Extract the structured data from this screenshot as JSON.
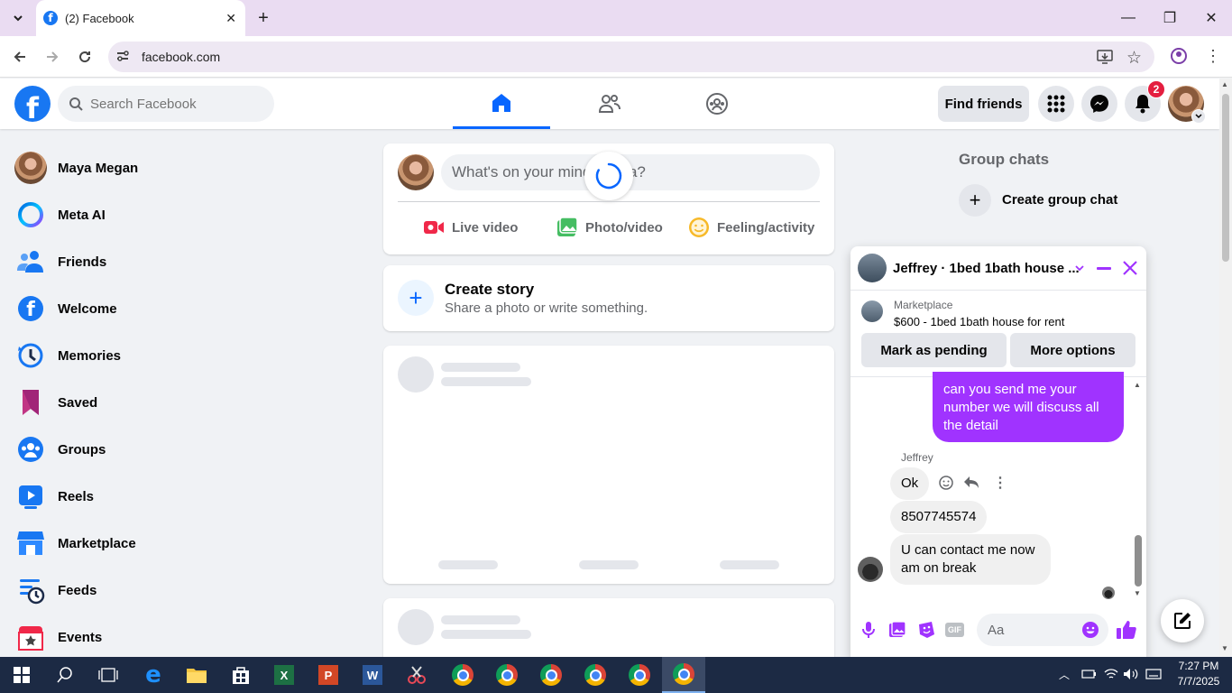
{
  "browser": {
    "tab_title": "(2) Facebook",
    "tab_favicon": "f",
    "url": "facebook.com",
    "new_tab": "+"
  },
  "header": {
    "search_placeholder": "Search Facebook",
    "find_friends": "Find friends",
    "notification_count": "2",
    "logo": "f"
  },
  "sidebar": {
    "items": [
      {
        "label": "Maya Megan",
        "icon": "profile-avatar"
      },
      {
        "label": "Meta AI",
        "icon": "meta-ai-icon"
      },
      {
        "label": "Friends",
        "icon": "friends-icon"
      },
      {
        "label": "Welcome",
        "icon": "facebook-icon"
      },
      {
        "label": "Memories",
        "icon": "clock-icon"
      },
      {
        "label": "Saved",
        "icon": "bookmark-icon"
      },
      {
        "label": "Groups",
        "icon": "groups-icon"
      },
      {
        "label": "Reels",
        "icon": "reels-icon"
      },
      {
        "label": "Marketplace",
        "icon": "shop-icon"
      },
      {
        "label": "Feeds",
        "icon": "feeds-icon"
      },
      {
        "label": "Events",
        "icon": "calendar-icon"
      }
    ]
  },
  "composer": {
    "placeholder": "What's on your mind, Maya?",
    "actions": [
      "Live video",
      "Photo/video",
      "Feeling/activity"
    ]
  },
  "story": {
    "title": "Create story",
    "subtitle": "Share a photo or write something."
  },
  "right": {
    "group_chats_title": "Group chats",
    "create_group_chat": "Create group chat"
  },
  "chat": {
    "title": "Jeffrey · 1bed 1bath house ...",
    "listing_source": "Marketplace",
    "listing_title": "$600 - 1bed 1bath house for rent",
    "mark_pending": "Mark as pending",
    "more_options": "More options",
    "messages": [
      {
        "sender": "me",
        "text": "can you send me your number we will discuss all the detail"
      },
      {
        "sender": "Jeffrey",
        "text": "Ok"
      },
      {
        "sender": "Jeffrey",
        "text": "8507745574"
      },
      {
        "sender": "Jeffrey",
        "text": "U can contact me now am on break"
      }
    ],
    "sender_name": "Jeffrey",
    "input_placeholder": "Aa",
    "gif_label": "GIF"
  },
  "taskbar": {
    "time": "7:27 PM",
    "date": "7/7/2025"
  },
  "colors": {
    "fb_blue": "#1877f2",
    "nav_active": "#0866ff",
    "messenger_purple": "#a033ff",
    "badge_red": "#e41e3f",
    "chrome_tabbar": "#eadcf2"
  }
}
